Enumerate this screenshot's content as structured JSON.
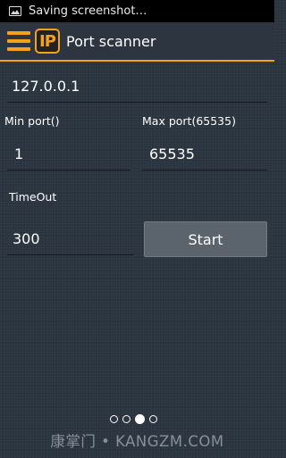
{
  "status_bar": {
    "notification_text": "Saving screenshot…",
    "icon": "image-icon"
  },
  "action_bar": {
    "logo_text": "IP",
    "title": "Port scanner",
    "accent_color": "#f5a21b",
    "menu_icon": "hamburger-menu-icon"
  },
  "form": {
    "host": {
      "value": "127.0.0.1"
    },
    "min_port": {
      "label": "Min port()",
      "value": "1"
    },
    "max_port": {
      "label": "Max port(65535)",
      "value": "65535"
    },
    "timeout": {
      "label": "TimeOut",
      "value": "300"
    },
    "start_label": "Start"
  },
  "pager": {
    "count": 4,
    "active_index": 2
  },
  "watermark": "康掌门 • KANGZM.COM"
}
